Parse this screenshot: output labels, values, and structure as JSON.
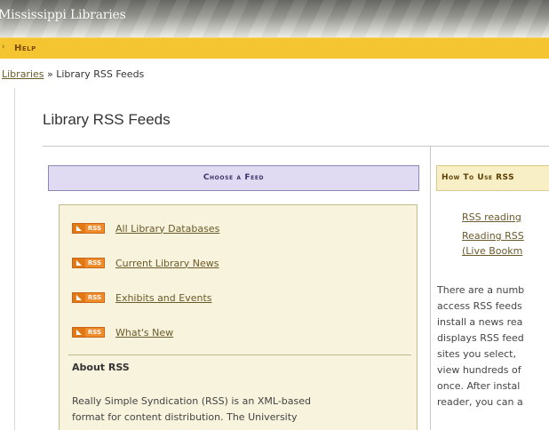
{
  "banner": {
    "title": "Mississippi Libraries"
  },
  "navbar": {
    "arrow": "›",
    "help_label": "Help"
  },
  "breadcrumb": {
    "link": "Libraries",
    "separator": " » ",
    "current": "Library RSS Feeds"
  },
  "page": {
    "title": "Library RSS Feeds"
  },
  "choose_feed": {
    "header": "Choose a Feed",
    "badge_text": "RSS",
    "badge_icon": "rss-wave-icon",
    "feeds": [
      {
        "label": "All Library Databases"
      },
      {
        "label": "Current Library News"
      },
      {
        "label": "Exhibits and Events"
      },
      {
        "label": "What's New"
      }
    ]
  },
  "about": {
    "heading": "About RSS",
    "lines": [
      "Really Simple Syndication (RSS) is an XML-based",
      "format for content distribution. The University"
    ]
  },
  "how_to": {
    "header": "How To Use RSS",
    "bullet": "•",
    "links": [
      {
        "lines": [
          "RSS reading"
        ]
      },
      {
        "lines": [
          "Reading RSS",
          "(Live Bookm"
        ]
      }
    ],
    "paragraph_lines": [
      "There are a numb",
      "access RSS feeds",
      "install a news rea",
      "displays RSS feed",
      "sites you select, ",
      "view hundreds of",
      "once. After instal",
      "reader, you can a"
    ]
  },
  "colors": {
    "banner": "#8f8f8a",
    "nav_bar": "#f4c531",
    "choose_header_bg": "#e0dbf3",
    "feed_box_bg": "#f7f3dd",
    "rss_badge": "#f08c2c",
    "link": "#6b5a2a"
  }
}
